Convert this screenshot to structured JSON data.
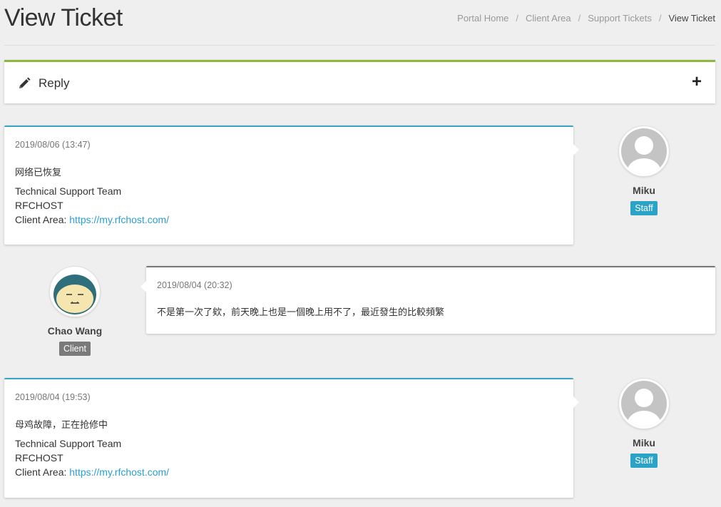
{
  "header": {
    "title": "View Ticket",
    "breadcrumb": [
      "Portal Home",
      "Client Area",
      "Support Tickets",
      "View Ticket"
    ]
  },
  "reply_panel": {
    "label": "Reply",
    "icon": "pencil-icon",
    "toggle": "+"
  },
  "messages": [
    {
      "role": "staff",
      "date": "2019/08/06 (13:47)",
      "body": "网络已恢复",
      "signature": [
        "Technical Support Team",
        "RFCHOST"
      ],
      "client_area_label": "Client Area: ",
      "client_area_link": "https://my.rfchost.com/",
      "author": "Miku",
      "badge": "Staff"
    },
    {
      "role": "client",
      "date": "2019/08/04 (20:32)",
      "body": "不是第一次了欸，前天晚上也是一個晚上用不了，最近發生的比較頻繁",
      "author": "Chao Wang",
      "badge": "Client"
    },
    {
      "role": "staff",
      "date": "2019/08/04 (19:53)",
      "body": "母鸡故障，正在抢修中",
      "signature": [
        "Technical Support Team",
        "RFCHOST"
      ],
      "client_area_label": "Client Area: ",
      "client_area_link": "https://my.rfchost.com/",
      "author": "Miku",
      "badge": "Staff"
    }
  ],
  "colors": {
    "background": "#efefef",
    "reply_accent": "#8fb73e",
    "staff_accent": "#3aa3c7",
    "client_accent": "#777777",
    "link": "#2a9fd0"
  }
}
